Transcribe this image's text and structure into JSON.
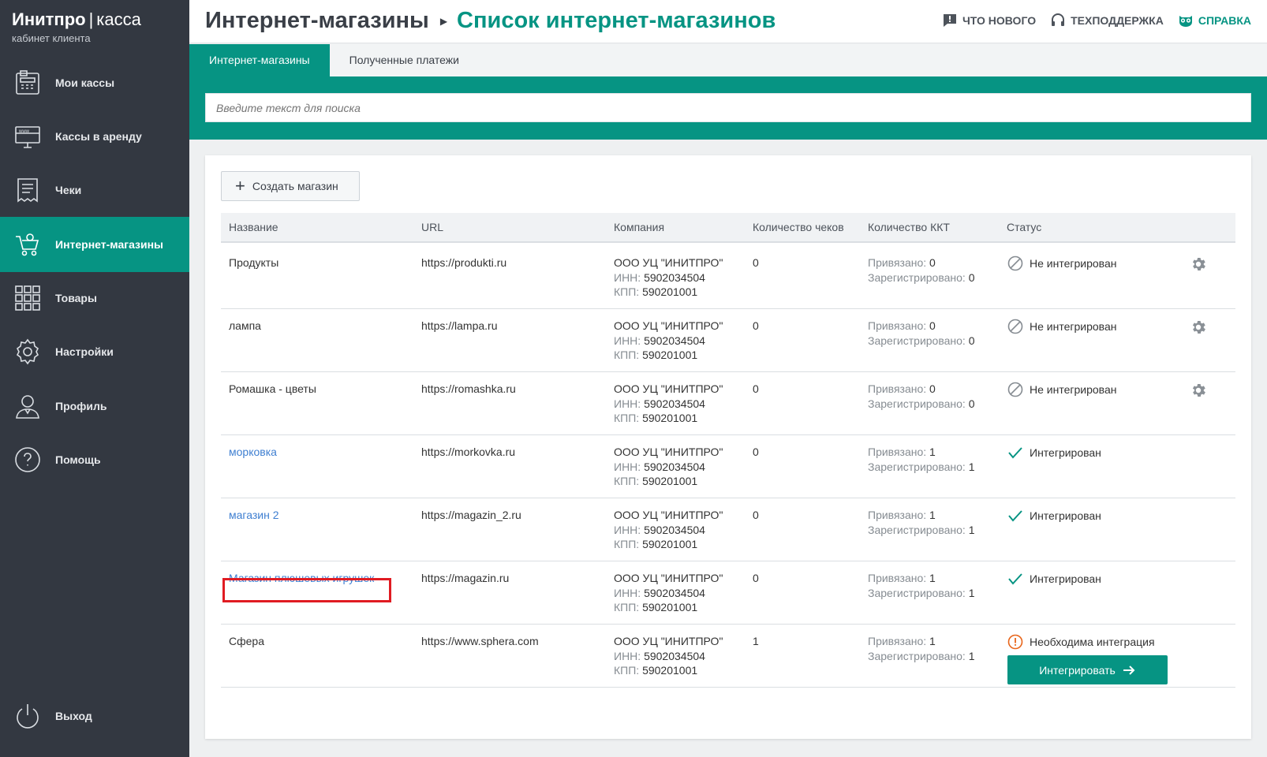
{
  "brand": {
    "name_bold": "Инитпро",
    "separator": "|",
    "name_light": "касса",
    "subtitle": "кабинет клиента"
  },
  "sidebar": {
    "items": [
      {
        "label": "Мои кассы",
        "icon": "cash-register-icon"
      },
      {
        "label": "Кассы в аренду",
        "icon": "www-monitor-icon"
      },
      {
        "label": "Чеки",
        "icon": "receipt-icon"
      },
      {
        "label": "Интернет-магазины",
        "icon": "shopping-cart-icon",
        "active": true
      },
      {
        "label": "Товары",
        "icon": "grid-icon"
      },
      {
        "label": "Настройки",
        "icon": "gear-icon"
      },
      {
        "label": "Профиль",
        "icon": "user-icon"
      },
      {
        "label": "Помощь",
        "icon": "question-icon"
      }
    ],
    "logout": {
      "label": "Выход",
      "icon": "power-icon"
    }
  },
  "header": {
    "breadcrumb_parent": "Интернет-магазины",
    "breadcrumb_current": "Список интернет-магазинов",
    "links": {
      "whats_new": "Что нового",
      "support": "Техподдержка",
      "help": "Справка"
    }
  },
  "tabs": [
    {
      "label": "Интернет-магазины",
      "active": true
    },
    {
      "label": "Полученные платежи",
      "active": false
    }
  ],
  "search": {
    "placeholder": "Введите текст для поиска"
  },
  "toolbar": {
    "create_label": "Создать магазин"
  },
  "table": {
    "headers": {
      "name": "Название",
      "url": "URL",
      "company": "Компания",
      "receipts": "Количество чеков",
      "kkt": "Количество ККТ",
      "status": "Статус"
    },
    "kkt_labels": {
      "bound": "Привязано:",
      "registered": "Зарегистрировано:"
    },
    "rows": [
      {
        "name": "Продукты",
        "name_link": false,
        "url": "https://produkti.ru",
        "company": "ООО УЦ \"ИНИТПРО\"",
        "inn_label": "ИНН:",
        "inn": "5902034504",
        "kpp_label": "КПП:",
        "kpp": "590201001",
        "receipts": "0",
        "bound": "0",
        "registered": "0",
        "status": "Не интегрирован",
        "status_type": "not-integrated"
      },
      {
        "name": "лампа",
        "name_link": false,
        "url": "https://lampa.ru",
        "company": "ООО УЦ \"ИНИТПРО\"",
        "inn_label": "ИНН:",
        "inn": "5902034504",
        "kpp_label": "КПП:",
        "kpp": "590201001",
        "receipts": "0",
        "bound": "0",
        "registered": "0",
        "status": "Не интегрирован",
        "status_type": "not-integrated"
      },
      {
        "name": "Ромашка - цветы",
        "name_link": false,
        "url": "https://romashka.ru",
        "company": "ООО УЦ \"ИНИТПРО\"",
        "inn_label": "ИНН:",
        "inn": "5902034504",
        "kpp_label": "КПП:",
        "kpp": "590201001",
        "receipts": "0",
        "bound": "0",
        "registered": "0",
        "status": "Не интегрирован",
        "status_type": "not-integrated"
      },
      {
        "name": "морковка",
        "name_link": true,
        "url": "https://morkovka.ru",
        "company": "ООО УЦ \"ИНИТПРО\"",
        "inn_label": "ИНН:",
        "inn": "5902034504",
        "kpp_label": "КПП:",
        "kpp": "590201001",
        "receipts": "0",
        "bound": "1",
        "registered": "1",
        "status": "Интегрирован",
        "status_type": "integrated"
      },
      {
        "name": "магазин 2",
        "name_link": true,
        "url": "https://magazin_2.ru",
        "company": "ООО УЦ \"ИНИТПРО\"",
        "inn_label": "ИНН:",
        "inn": "5902034504",
        "kpp_label": "КПП:",
        "kpp": "590201001",
        "receipts": "0",
        "bound": "1",
        "registered": "1",
        "status": "Интегрирован",
        "status_type": "integrated"
      },
      {
        "name": "Магазин плюшевых игрушек",
        "name_link": true,
        "highlighted": true,
        "url": "https://magazin.ru",
        "company": "ООО УЦ \"ИНИТПРО\"",
        "inn_label": "ИНН:",
        "inn": "5902034504",
        "kpp_label": "КПП:",
        "kpp": "590201001",
        "receipts": "0",
        "bound": "1",
        "registered": "1",
        "status": "Интегрирован",
        "status_type": "integrated"
      },
      {
        "name": "Сфера",
        "name_link": false,
        "url": "https://www.sphera.com",
        "company": "ООО УЦ \"ИНИТПРО\"",
        "inn_label": "ИНН:",
        "inn": "5902034504",
        "kpp_label": "КПП:",
        "kpp": "590201001",
        "receipts": "1",
        "bound": "1",
        "registered": "1",
        "status": "Необходима интеграция",
        "status_type": "needs-integration",
        "action_label": "Интегрировать"
      }
    ]
  },
  "colors": {
    "accent": "#069483",
    "sidebar": "#333841",
    "link": "#3f7fd1",
    "warning": "#e8651a",
    "highlight": "#e01b22"
  }
}
